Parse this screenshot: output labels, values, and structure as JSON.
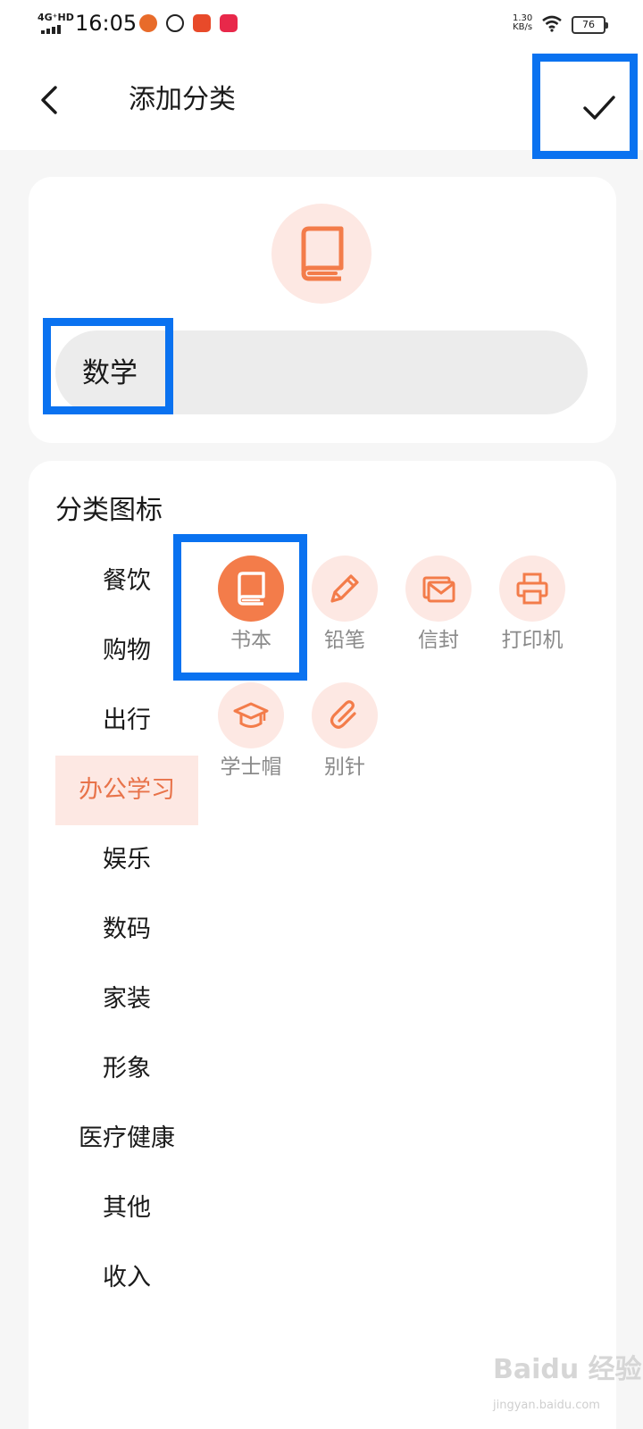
{
  "status_bar": {
    "network": "4G⁺HD",
    "time": "16:05",
    "speed_value": "1.30",
    "speed_unit": "KB/s",
    "battery": "76"
  },
  "header": {
    "title": "添加分类",
    "back_icon": "chevron-left-icon",
    "confirm_icon": "checkmark-icon"
  },
  "preview": {
    "icon": "book-icon",
    "name_value": "数学"
  },
  "icon_section": {
    "title": "分类图标",
    "categories": [
      {
        "label": "餐饮"
      },
      {
        "label": "购物"
      },
      {
        "label": "出行"
      },
      {
        "label": "办公学习",
        "active": true
      },
      {
        "label": "娱乐"
      },
      {
        "label": "数码"
      },
      {
        "label": "家装"
      },
      {
        "label": "形象"
      },
      {
        "label": "医疗健康"
      },
      {
        "label": "其他"
      },
      {
        "label": "收入"
      }
    ],
    "icons": [
      {
        "label": "书本",
        "icon": "book-icon",
        "selected": true
      },
      {
        "label": "铅笔",
        "icon": "pencil-icon"
      },
      {
        "label": "信封",
        "icon": "envelope-icon"
      },
      {
        "label": "打印机",
        "icon": "printer-icon"
      },
      {
        "label": "学士帽",
        "icon": "graduation-cap-icon"
      },
      {
        "label": "别针",
        "icon": "paperclip-icon"
      }
    ]
  },
  "colors": {
    "accent": "#f37c4a",
    "accent_light": "#fde8e3",
    "highlight_box": "#0a72f0"
  },
  "watermark": {
    "text": "Baidu 经验",
    "sub": "jingyan.baidu.com"
  }
}
